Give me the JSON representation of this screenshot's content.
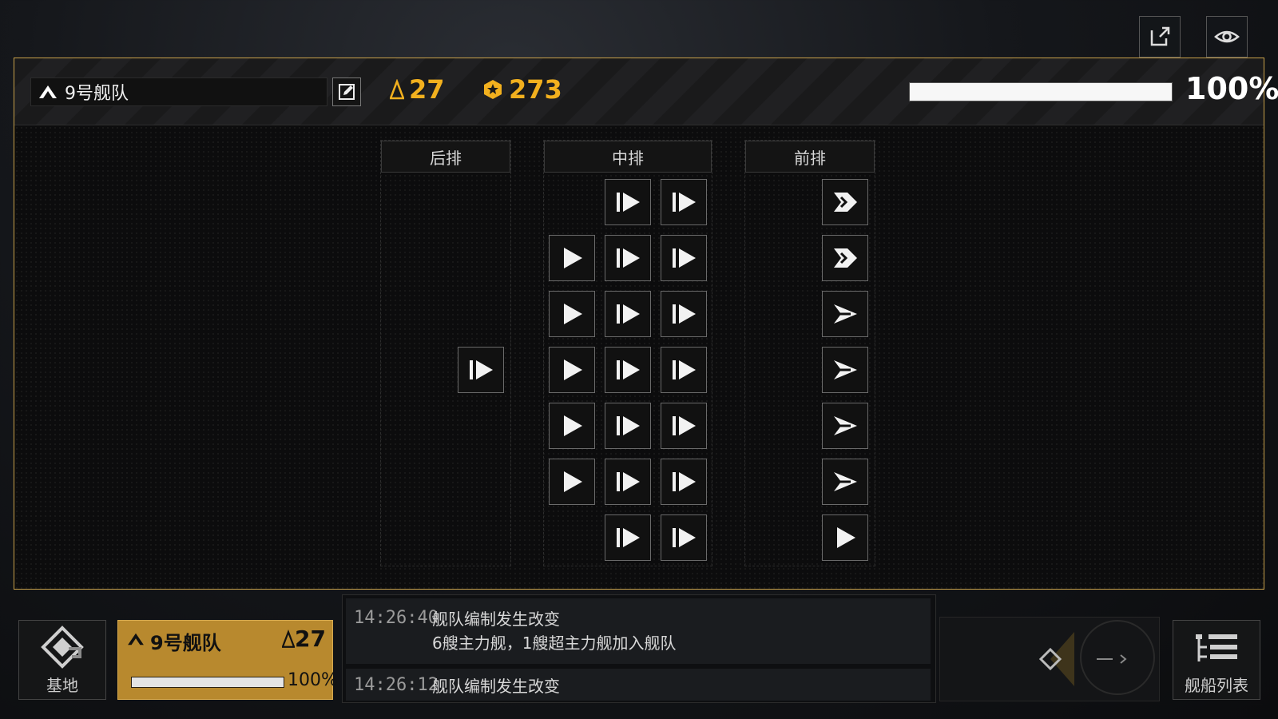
{
  "fleet": {
    "name": "9号舰队",
    "power": "27",
    "ap": "273",
    "progress_pct": "100%",
    "progress_value": 1.0
  },
  "columns": {
    "rear": "后排",
    "middle": "中排",
    "front": "前排"
  },
  "bottom": {
    "base_label": "基地",
    "fleet_card": {
      "name": "9号舰队",
      "power": "27",
      "pct": "100%"
    },
    "ship_list_label": "舰船列表"
  },
  "log": [
    {
      "time": "14:26:40",
      "line1": "舰队编制发生改变",
      "line2": "6艘主力舰，1艘超主力舰加入舰队"
    },
    {
      "time": "14:26:12",
      "line1": "舰队编制发生改变"
    }
  ],
  "colors": {
    "accent_gold": "#f2b01e",
    "card_gold": "#b8892e",
    "panel_border": "#c9a14a"
  },
  "icons": [
    "share-icon",
    "eye-icon",
    "fleet-triangle-icon",
    "edit-icon",
    "power-icon",
    "ap-icon",
    "base-icon",
    "ship-list-icon",
    "ship-icon"
  ]
}
